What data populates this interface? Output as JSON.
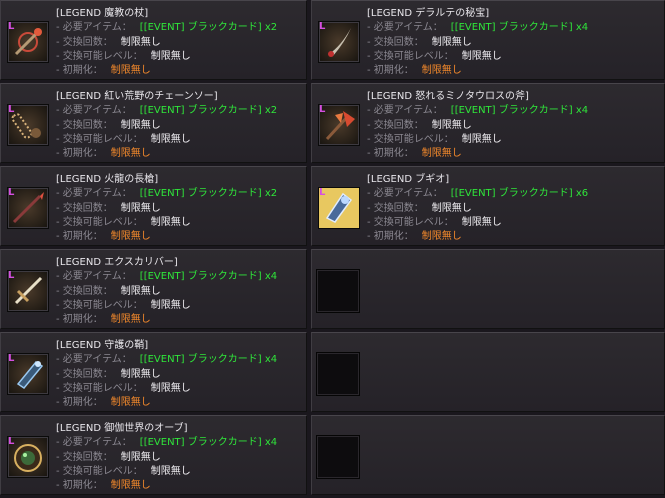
{
  "labels": {
    "required": "- 必要アイテム：",
    "count": "- 交換回数：",
    "level": "- 交換可能レベル：",
    "init": "- 初期化："
  },
  "left": [
    {
      "title": "[LEGEND 魔教の杖]",
      "req": "[[EVENT] ブラックカード] x2",
      "count": "制限無し",
      "level": "制限無し",
      "init": "制限無し",
      "icon": "staff-icon"
    },
    {
      "title": "[LEGEND 紅い荒野のチェーンソー]",
      "req": "[[EVENT] ブラックカード] x2",
      "count": "制限無し",
      "level": "制限無し",
      "init": "制限無し",
      "icon": "chainsaw-icon"
    },
    {
      "title": "[LEGEND 火龍の長槍]",
      "req": "[[EVENT] ブラックカード] x2",
      "count": "制限無し",
      "level": "制限無し",
      "init": "制限無し",
      "icon": "spear-icon"
    },
    {
      "title": "[LEGEND エクスカリバー]",
      "req": "[[EVENT] ブラックカード] x4",
      "count": "制限無し",
      "level": "制限無し",
      "init": "制限無し",
      "icon": "sword-icon"
    },
    {
      "title": "[LEGEND 守護の鞘]",
      "req": "[[EVENT] ブラックカード] x4",
      "count": "制限無し",
      "level": "制限無し",
      "init": "制限無し",
      "icon": "sheath-icon"
    },
    {
      "title": "[LEGEND 御伽世界のオーブ]",
      "req": "[[EVENT] ブラックカード] x4",
      "count": "制限無し",
      "level": "制限無し",
      "init": "制限無し",
      "icon": "orb-icon"
    }
  ],
  "right": [
    {
      "title": "[LEGEND デラルテの秘宝]",
      "req": "[[EVENT] ブラックカード] x4",
      "count": "制限無し",
      "level": "制限無し",
      "init": "制限無し",
      "icon": "dagger-icon"
    },
    {
      "title": "[LEGEND 怒れるミノタウロスの斧]",
      "req": "[[EVENT] ブラックカード] x4",
      "count": "制限無し",
      "level": "制限無し",
      "init": "制限無し",
      "icon": "axe-icon"
    },
    {
      "title": "[LEGEND ブギオ]",
      "req": "[[EVENT] ブラックカード] x6",
      "count": "制限無し",
      "level": "制限無し",
      "init": "制限無し",
      "icon": "shield-icon"
    }
  ],
  "legend_mark": "L",
  "colors": {
    "title": "#e9e7ec",
    "label": "#8b8891",
    "item": "#2fe63a",
    "value": "#f2f0f4",
    "init_value": "#f58a2b",
    "legend": "#d54fe0"
  }
}
